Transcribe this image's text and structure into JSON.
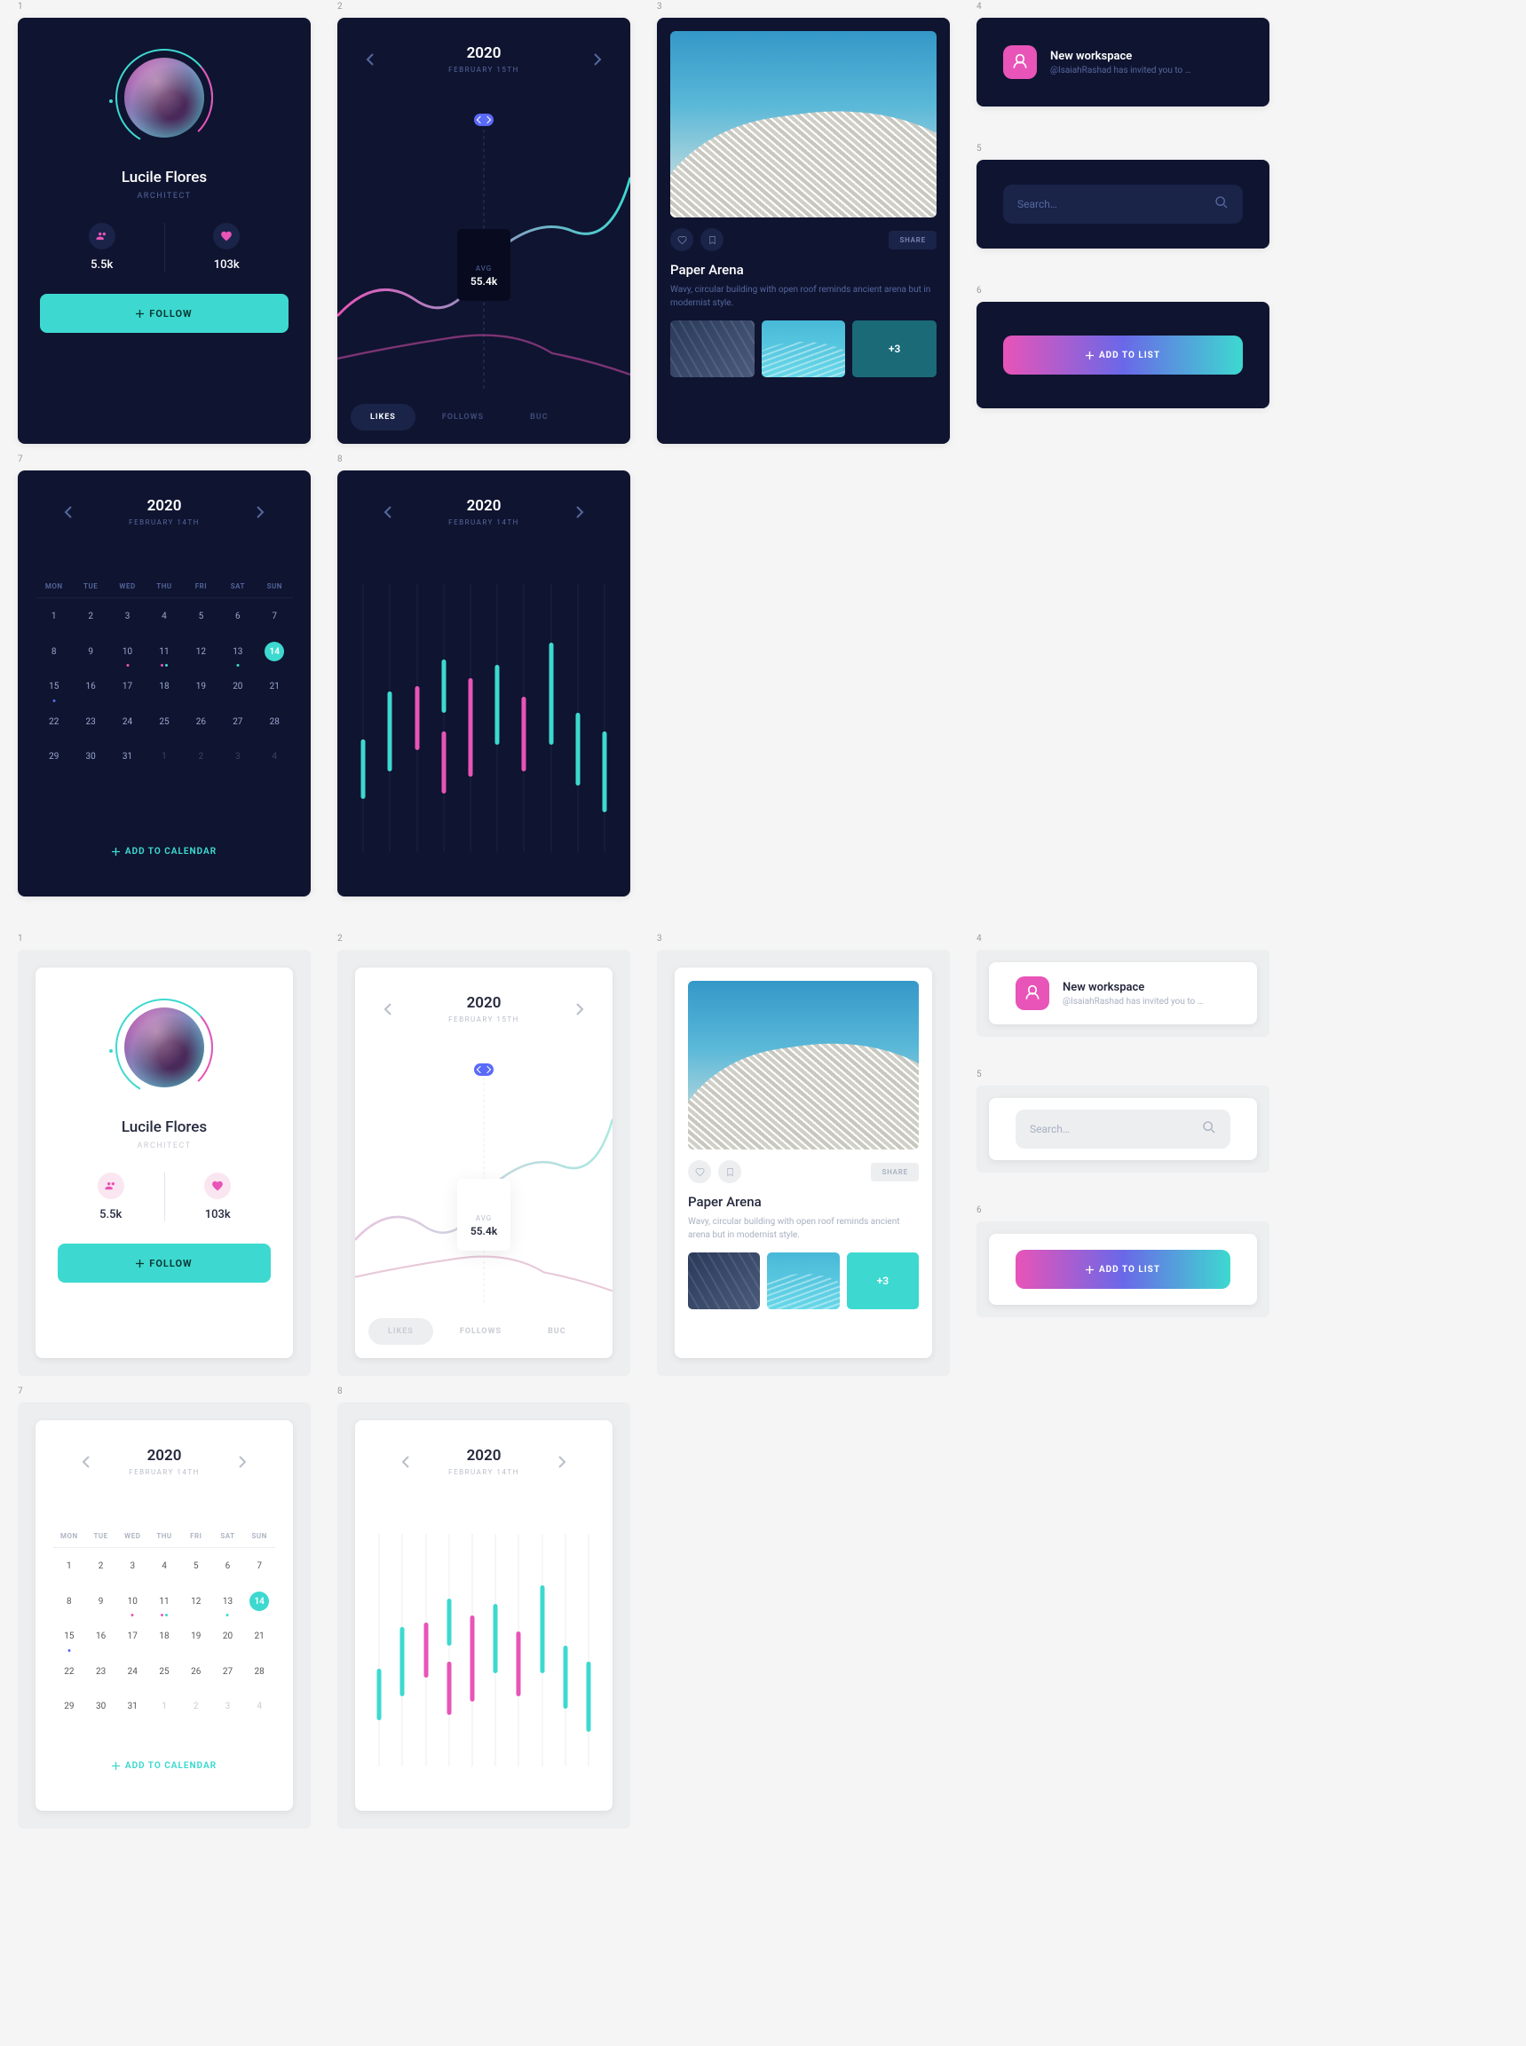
{
  "profile": {
    "name": "Lucile Flores",
    "role": "ARCHITECT",
    "followers": "5.5k",
    "likes": "103k",
    "follow_label": "FOLLOW"
  },
  "line_chart": {
    "year": "2020",
    "date": "FEBRUARY 15TH",
    "avg_label": "AVG",
    "avg_value": "55.4k",
    "tabs": [
      "LIKES",
      "FOLLOWS",
      "BUC"
    ]
  },
  "image_card": {
    "title": "Paper Arena",
    "desc": "Wavy, circular building with open roof reminds ancient arena but in modernist style.",
    "share": "SHARE",
    "more_count": "+3"
  },
  "notification": {
    "title": "New workspace",
    "subtitle": "@IsaiahRashad has invited you to …"
  },
  "search": {
    "placeholder": "Search…"
  },
  "addlist": {
    "label": "ADD TO LIST"
  },
  "calendar": {
    "year": "2020",
    "date": "FEBRUARY 14TH",
    "dow": [
      "MON",
      "TUE",
      "WED",
      "THU",
      "FRI",
      "SAT",
      "SUN"
    ],
    "add_label": "ADD TO CALENDAR"
  },
  "candle": {
    "year": "2020",
    "date": "FEBRUARY 14TH"
  },
  "chart_data": [
    {
      "type": "line",
      "title": "Likes over time",
      "avg_value": 55.4,
      "units": "k",
      "x_domain": [
        0,
        100
      ],
      "series": [
        {
          "name": "likes",
          "color": "#3dd9d0",
          "points": [
            [
              0,
              30
            ],
            [
              15,
              50
            ],
            [
              30,
              38
            ],
            [
              50,
              55
            ],
            [
              70,
              80
            ],
            [
              85,
              70
            ],
            [
              100,
              90
            ]
          ]
        },
        {
          "name": "secondary",
          "color": "#e854b8",
          "points": [
            [
              0,
              15
            ],
            [
              20,
              20
            ],
            [
              40,
              30
            ],
            [
              60,
              25
            ],
            [
              80,
              18
            ],
            [
              100,
              10
            ]
          ]
        }
      ]
    },
    {
      "type": "candlestick",
      "title": "Daily range",
      "columns": 10,
      "y_domain": [
        0,
        100
      ],
      "bars": [
        {
          "col": 1,
          "color": "g",
          "top": 58,
          "bottom": 80
        },
        {
          "col": 2,
          "color": "g",
          "top": 40,
          "bottom": 70
        },
        {
          "col": 3,
          "color": "p",
          "top": 38,
          "bottom": 62
        },
        {
          "col": 4,
          "color": "g",
          "top": 28,
          "bottom": 48
        },
        {
          "col": 4,
          "color": "p",
          "top": 55,
          "bottom": 78
        },
        {
          "col": 5,
          "color": "p",
          "top": 35,
          "bottom": 72
        },
        {
          "col": 6,
          "color": "g",
          "top": 30,
          "bottom": 60
        },
        {
          "col": 7,
          "color": "p",
          "top": 42,
          "bottom": 70
        },
        {
          "col": 8,
          "color": "g",
          "top": 22,
          "bottom": 60
        },
        {
          "col": 9,
          "color": "g",
          "top": 48,
          "bottom": 75
        },
        {
          "col": 10,
          "color": "g",
          "top": 55,
          "bottom": 85
        }
      ]
    }
  ],
  "calendar_days": [
    [
      {
        "n": 1
      },
      {
        "n": 2
      },
      {
        "n": 3
      },
      {
        "n": 4
      },
      {
        "n": 5
      },
      {
        "n": 6
      },
      {
        "n": 7
      }
    ],
    [
      {
        "n": 8
      },
      {
        "n": 9
      },
      {
        "n": 10,
        "dots": [
          "dp"
        ]
      },
      {
        "n": 11,
        "dots": [
          "dp",
          "dg"
        ]
      },
      {
        "n": 12
      },
      {
        "n": 13,
        "dots": [
          "dg"
        ]
      },
      {
        "n": 14,
        "sel": true
      }
    ],
    [
      {
        "n": 15,
        "dots": [
          "db"
        ]
      },
      {
        "n": 16
      },
      {
        "n": 17
      },
      {
        "n": 18
      },
      {
        "n": 19
      },
      {
        "n": 20
      },
      {
        "n": 21
      }
    ],
    [
      {
        "n": 22
      },
      {
        "n": 23
      },
      {
        "n": 24
      },
      {
        "n": 25
      },
      {
        "n": 26
      },
      {
        "n": 27
      },
      {
        "n": 28
      }
    ],
    [
      {
        "n": 29
      },
      {
        "n": 30
      },
      {
        "n": 31
      },
      {
        "n": 1,
        "other": true
      },
      {
        "n": 2,
        "other": true
      },
      {
        "n": 3,
        "other": true
      },
      {
        "n": 4,
        "other": true
      }
    ]
  ]
}
